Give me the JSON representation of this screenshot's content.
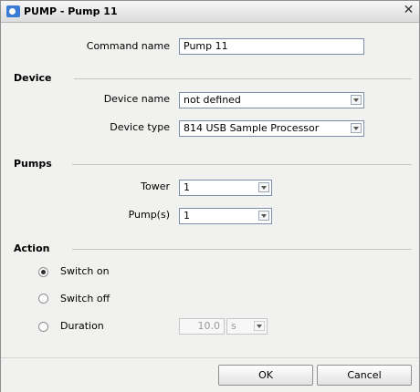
{
  "window": {
    "title": "PUMP - Pump 11",
    "close_glyph": "✕"
  },
  "command": {
    "label": "Command name",
    "value": "Pump 11"
  },
  "device": {
    "section_title": "Device",
    "device_name": {
      "label": "Device name",
      "value": "not defined"
    },
    "device_type": {
      "label": "Device type",
      "value": "814 USB Sample Processor"
    }
  },
  "pumps": {
    "section_title": "Pumps",
    "tower": {
      "label": "Tower",
      "value": "1"
    },
    "pumps": {
      "label": "Pump(s)",
      "value": "1"
    }
  },
  "action": {
    "section_title": "Action",
    "options": [
      {
        "label": "Switch on",
        "checked": true
      },
      {
        "label": "Switch off",
        "checked": false
      },
      {
        "label": "Duration",
        "checked": false
      }
    ],
    "duration": {
      "value": "10.0",
      "unit": "s"
    }
  },
  "buttons": {
    "ok": "OK",
    "cancel": "Cancel"
  }
}
